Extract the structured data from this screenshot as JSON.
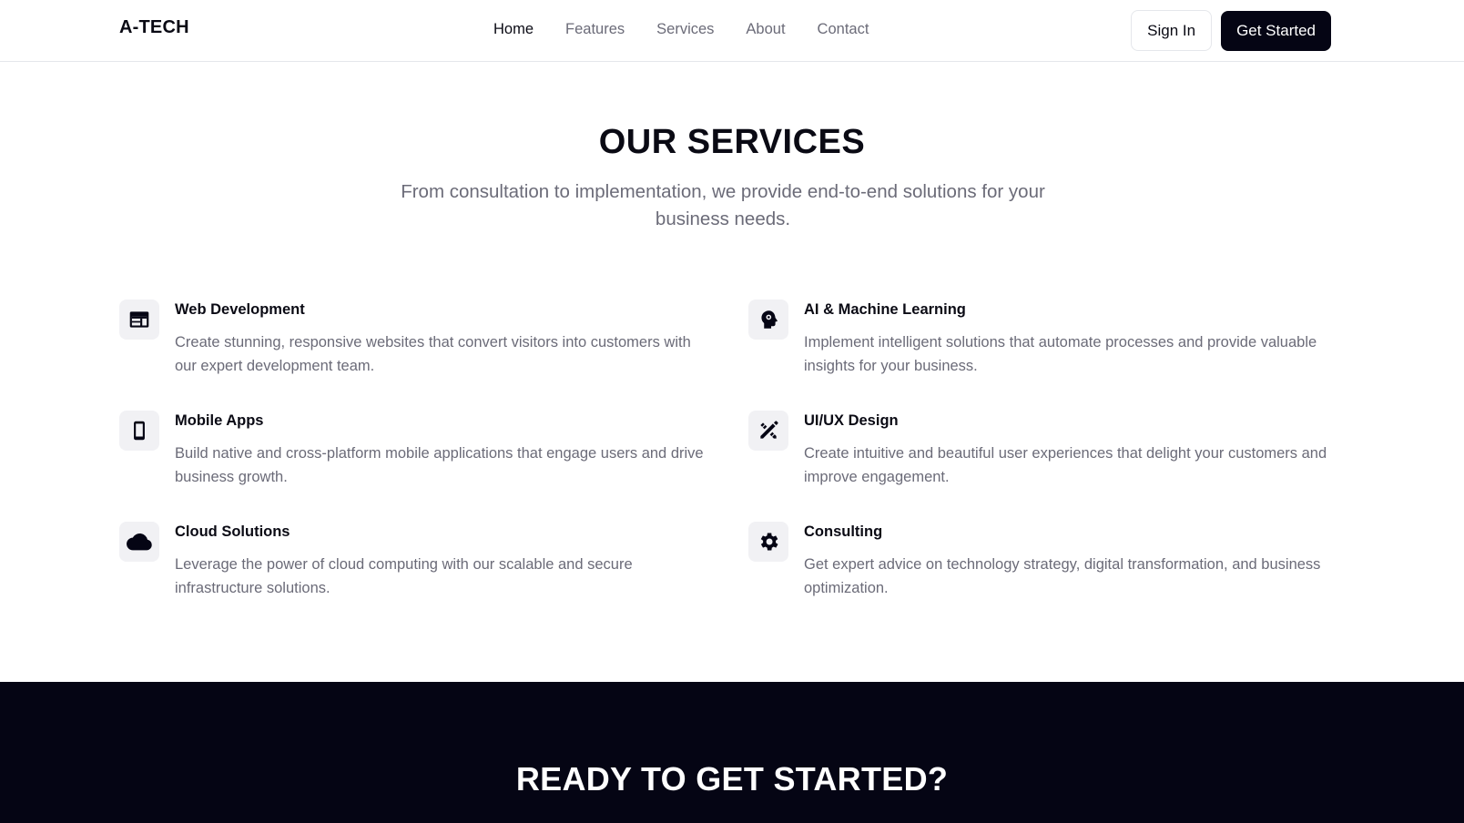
{
  "header": {
    "brand": "A-TECH",
    "nav": [
      {
        "label": "Home",
        "active": true
      },
      {
        "label": "Features",
        "active": false
      },
      {
        "label": "Services",
        "active": false
      },
      {
        "label": "About",
        "active": false
      },
      {
        "label": "Contact",
        "active": false
      }
    ],
    "signin_label": "Sign In",
    "get_started_label": "Get Started"
  },
  "services": {
    "title": "OUR SERVICES",
    "subtitle": "From consultation to implementation, we provide end-to-end solutions for your business needs.",
    "items": [
      {
        "icon": "browser-window-icon",
        "title": "Web Development",
        "description": "Create stunning, responsive websites that convert visitors into customers with our expert development team."
      },
      {
        "icon": "brain-head-icon",
        "title": "AI & Machine Learning",
        "description": "Implement intelligent solutions that automate processes and provide valuable insights for your business."
      },
      {
        "icon": "smartphone-icon",
        "title": "Mobile Apps",
        "description": "Build native and cross-platform mobile applications that engage users and drive business growth."
      },
      {
        "icon": "design-tools-icon",
        "title": "UI/UX Design",
        "description": "Create intuitive and beautiful user experiences that delight your customers and improve engagement."
      },
      {
        "icon": "cloud-icon",
        "title": "Cloud Solutions",
        "description": "Leverage the power of cloud computing with our scalable and secure infrastructure solutions."
      },
      {
        "icon": "gear-icon",
        "title": "Consulting",
        "description": "Get expert advice on technology strategy, digital transformation, and business optimization."
      }
    ]
  },
  "cta": {
    "title": "READY TO GET STARTED?"
  },
  "colors": {
    "primary": "#050514",
    "muted_text": "#6b6b78",
    "icon_bg": "#f1f1f4",
    "border": "#e5e7eb"
  }
}
